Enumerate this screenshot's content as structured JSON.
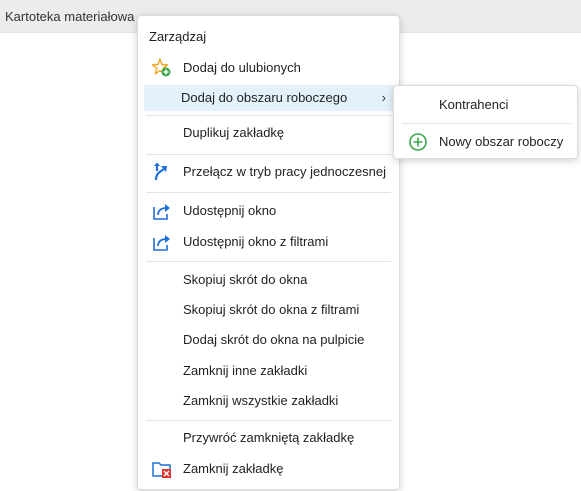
{
  "tab": {
    "title": "Kartoteka materiałowa"
  },
  "menu": {
    "header": "Zarządzaj",
    "items": [
      {
        "label": "Dodaj do ulubionych",
        "icon": "star-add-icon"
      },
      {
        "label": "Dodaj do obszaru roboczego",
        "icon": "",
        "submenu_arrow": "›"
      },
      {
        "label": "Duplikuj zakładkę",
        "icon": ""
      },
      {
        "label": "Przełącz w tryb pracy jednoczesnej",
        "icon": "split-arrows-icon"
      },
      {
        "label": "Udostępnij okno",
        "icon": "share-icon"
      },
      {
        "label": "Udostępnij okno z filtrami",
        "icon": "share-icon"
      },
      {
        "label": "Skopiuj skrót do okna",
        "icon": ""
      },
      {
        "label": "Skopiuj skrót do okna z filtrami",
        "icon": ""
      },
      {
        "label": "Dodaj skrót do okna na pulpicie",
        "icon": ""
      },
      {
        "label": "Zamknij inne zakładki",
        "icon": ""
      },
      {
        "label": "Zamknij wszystkie zakładki",
        "icon": ""
      },
      {
        "label": "Przywróć zamkniętą zakładkę",
        "icon": ""
      },
      {
        "label": "Zamknij zakładkę",
        "icon": "folder-close-icon"
      }
    ]
  },
  "submenu": {
    "items": [
      {
        "label": "Kontrahenci",
        "icon": ""
      },
      {
        "label": "Nowy obszar roboczy",
        "icon": "plus-circle-icon"
      }
    ]
  },
  "colors": {
    "highlight": "#e3f1fb",
    "accent_blue": "#1e6fd9",
    "star_orange": "#f5a623",
    "add_green": "#3aa84a",
    "close_red": "#e0342f"
  }
}
